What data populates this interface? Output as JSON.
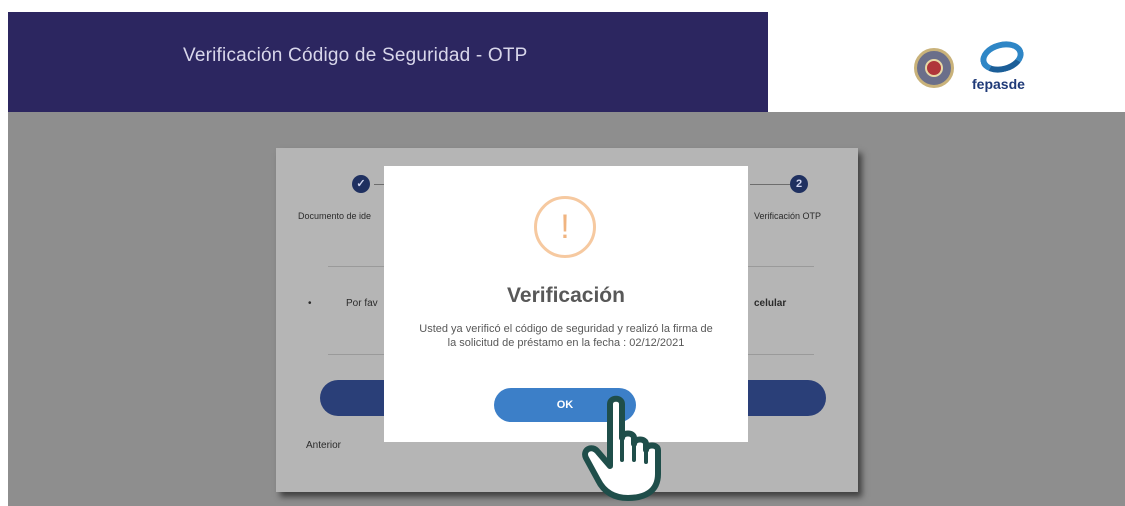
{
  "header": {
    "title": "Verificación Código de Seguridad - OTP",
    "logo_seal_icon": "institution-seal-icon",
    "logo_brand_icon": "fepasde-logo-icon",
    "logo_brand_text": "fepasde",
    "bar_color": "#2c2660"
  },
  "stepper": {
    "step1": {
      "icon": "check-icon",
      "label": "Documento de ide"
    },
    "step2": {
      "number": "2",
      "label": "Verificación OTP"
    }
  },
  "form": {
    "instruction_left": "Por fav",
    "instruction_right": "celular",
    "previous_label": "Anterior"
  },
  "modal": {
    "icon": "warning-icon",
    "icon_glyph": "!",
    "title": "Verificación",
    "message": "Usted ya verificó el código de seguridad y realizó la firma de la solicitud de préstamo en la fecha : 02/12/2021",
    "ok_label": "OK",
    "accent_color": "#3c7fc8",
    "warning_color": "#f0b480"
  },
  "cursor": {
    "icon": "pointer-hand-icon"
  }
}
